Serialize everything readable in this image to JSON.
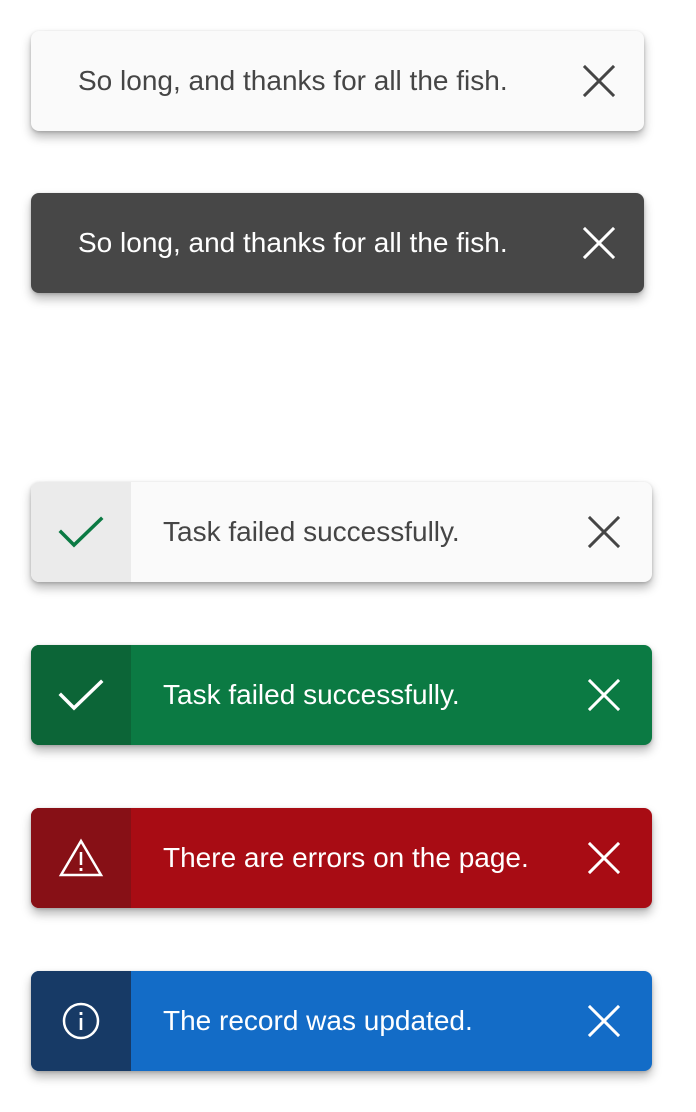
{
  "colors": {
    "light_bg": "#fafafa",
    "light_text": "#454545",
    "dark_bg": "#474747",
    "success_bg": "#0b7a43",
    "success_accent": "#0c6537",
    "success_icon_light": "#0b7a43",
    "error_bg": "#a80c14",
    "error_accent": "#871016",
    "info_bg": "#136cc7",
    "info_accent": "#173a66"
  },
  "toasts": [
    {
      "variant": "default-light",
      "message": "So long, and thanks for all the fish.",
      "close_icon": "close-icon"
    },
    {
      "variant": "default-dark",
      "message": "So long, and thanks for all the fish.",
      "close_icon": "close-icon"
    },
    {
      "variant": "success-light",
      "icon": "checkmark-icon",
      "message": "Task failed successfully.",
      "close_icon": "close-icon"
    },
    {
      "variant": "success",
      "icon": "checkmark-icon",
      "message": "Task failed successfully.",
      "close_icon": "close-icon"
    },
    {
      "variant": "error",
      "icon": "warning-icon",
      "message": "There are errors on the page.",
      "close_icon": "close-icon"
    },
    {
      "variant": "info",
      "icon": "info-icon",
      "message": "The record was updated.",
      "close_icon": "close-icon"
    }
  ]
}
